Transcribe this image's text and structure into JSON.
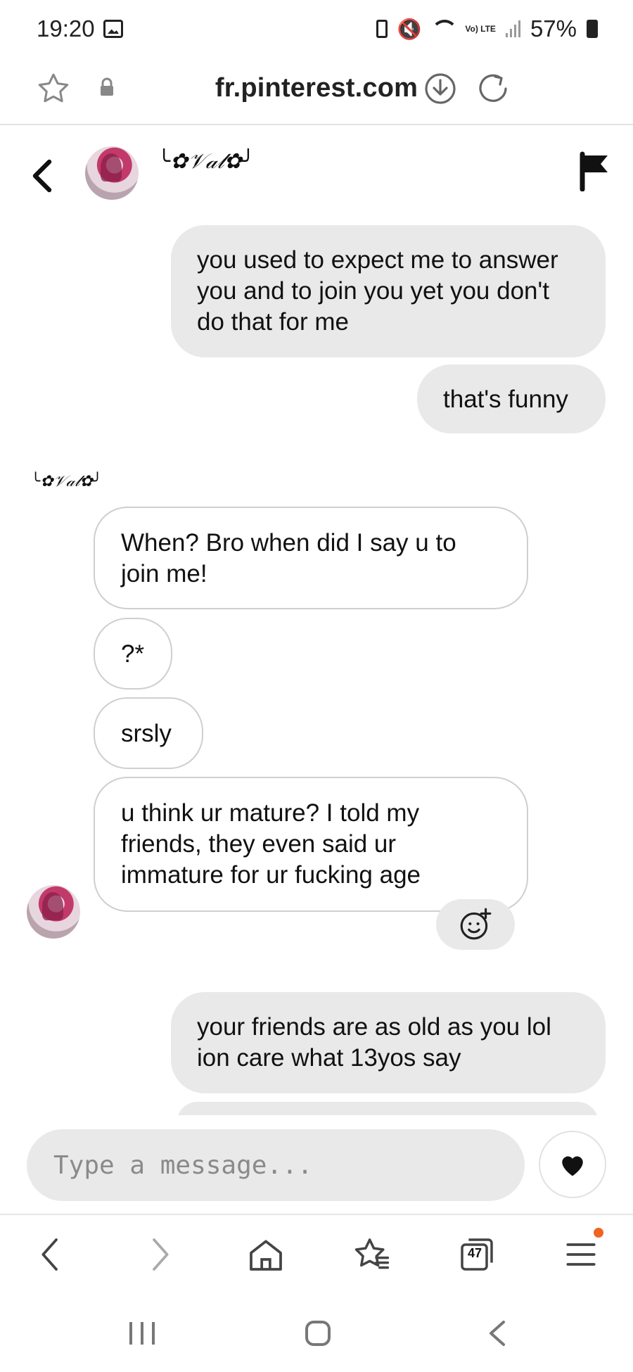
{
  "status_bar": {
    "time": "19:20",
    "battery_percent": "57%",
    "lte_label": "Vo) LTE"
  },
  "browser": {
    "url": "fr.pinterest.com",
    "tabs_count": "47",
    "menu_has_notification": true
  },
  "chat": {
    "contact_name": "╰✿𝒱𝒶𝓁✿╯",
    "messages": [
      {
        "direction": "out",
        "text": "you used to expect me to answer you and to join you yet you don't do that for me"
      },
      {
        "direction": "out",
        "text": "that's funny"
      },
      {
        "direction": "in",
        "text": "When? Bro when did I say u to join me!"
      },
      {
        "direction": "in",
        "text": "?*"
      },
      {
        "direction": "in",
        "text": "srsly"
      },
      {
        "direction": "in",
        "text": "u think ur mature? I told my friends, they even said ur immature for ur fucking age"
      },
      {
        "direction": "out",
        "text": "your friends are as old as you lol ion care what 13yos say"
      }
    ],
    "input_placeholder": "Type a message..."
  },
  "colors": {
    "outgoing_bubble": "#e9e9e9",
    "incoming_border": "#cfcfcf",
    "accent_badge": "#f06422"
  }
}
